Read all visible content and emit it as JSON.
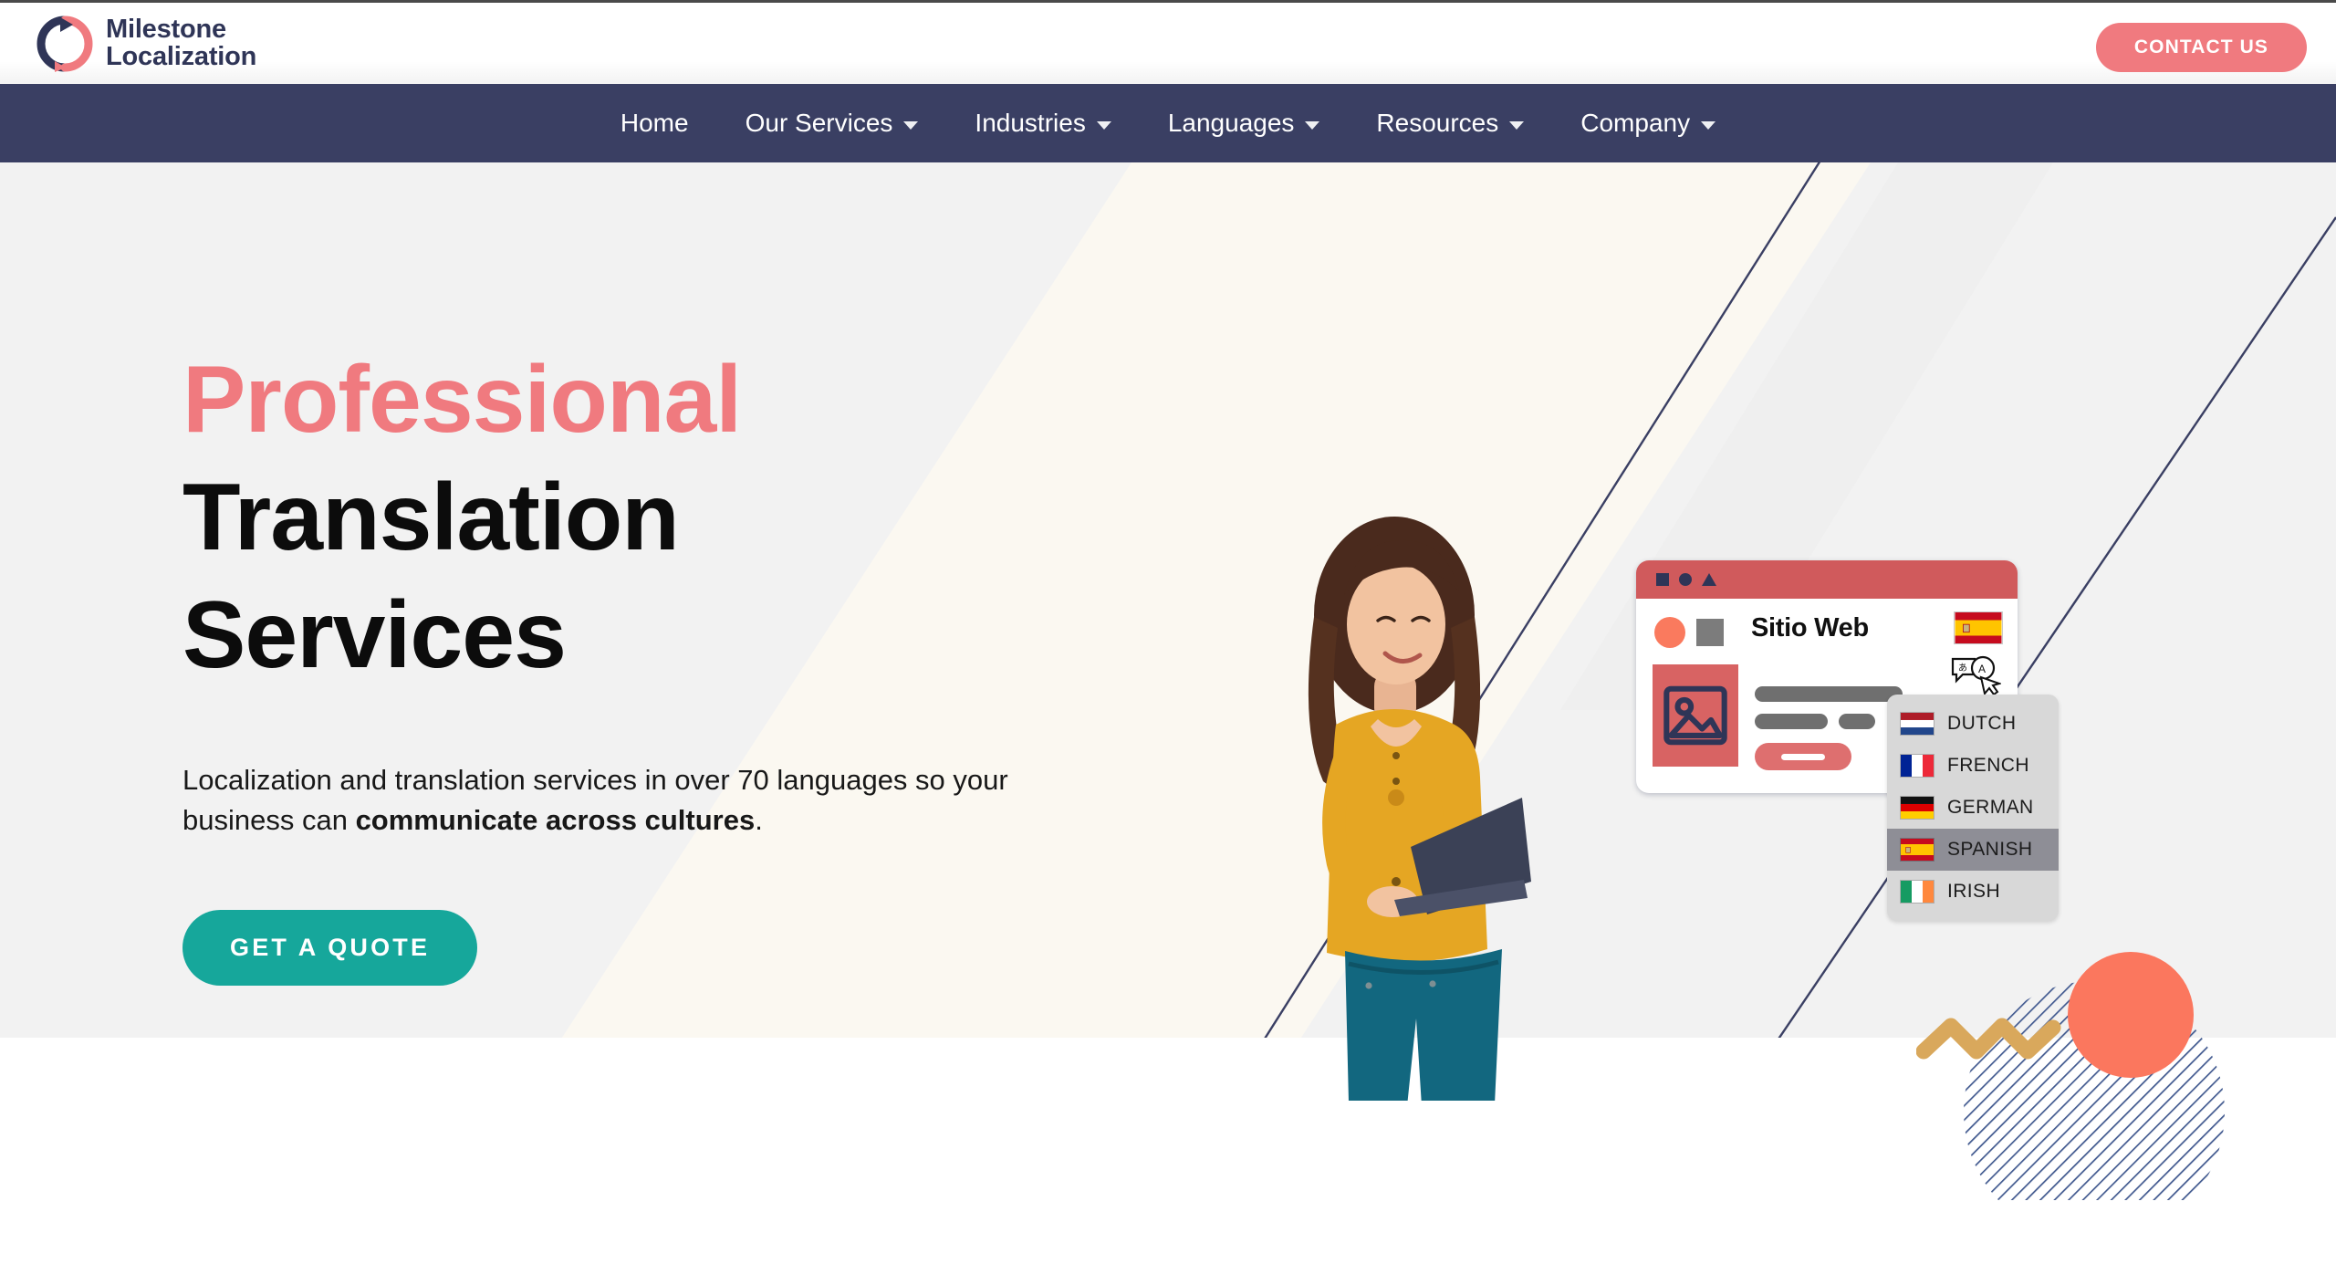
{
  "header": {
    "logo": {
      "line1": "Milestone",
      "line2": "Localization",
      "icon": "milestone-ring-logo",
      "color_dark": "#2f3557",
      "color_accent": "#f07a7f"
    },
    "contact_button": {
      "label": "CONTACT US",
      "color": "#f07a7f"
    }
  },
  "nav": {
    "background": "#3a3f63",
    "items": [
      {
        "label": "Home",
        "has_dropdown": false
      },
      {
        "label": "Our Services",
        "has_dropdown": true
      },
      {
        "label": "Industries",
        "has_dropdown": true
      },
      {
        "label": "Languages",
        "has_dropdown": true
      },
      {
        "label": "Resources",
        "has_dropdown": true
      },
      {
        "label": "Company",
        "has_dropdown": true
      }
    ]
  },
  "hero": {
    "background": "#f2f2f2",
    "headline_accent": "Professional",
    "headline_line2": "Translation",
    "headline_line3": "Services",
    "subtext_part1": "Localization and translation services in over 70 languages so your business can ",
    "subtext_bold": "communicate across cultures",
    "subtext_part2": ".",
    "cta_button": {
      "label": "GET A QUOTE",
      "color": "#16a79b"
    }
  },
  "illustration": {
    "person_alt": "woman-with-laptop-photo",
    "browser_mockup": {
      "title": "Sitio Web",
      "titlebar_color": "#d05a5c",
      "titlebar_icons": [
        "square-icon",
        "circle-icon",
        "triangle-icon"
      ],
      "flag": "spain-flag-icon",
      "translate_icon": "translate-cursor-icon",
      "image_placeholder": "image-placeholder-icon"
    },
    "language_dropdown": {
      "selected": "SPANISH",
      "options": [
        {
          "label": "DUTCH",
          "flag": "netherlands-flag-icon"
        },
        {
          "label": "FRENCH",
          "flag": "france-flag-icon"
        },
        {
          "label": "GERMAN",
          "flag": "germany-flag-icon"
        },
        {
          "label": "SPANISH",
          "flag": "spain-flag-icon"
        },
        {
          "label": "IRISH",
          "flag": "ireland-flag-icon"
        }
      ]
    },
    "decorations": {
      "striped_circle_color": "#3d5a96",
      "solid_circle_color": "#fb775e",
      "zigzag_color": "#d9a košt"
    }
  }
}
